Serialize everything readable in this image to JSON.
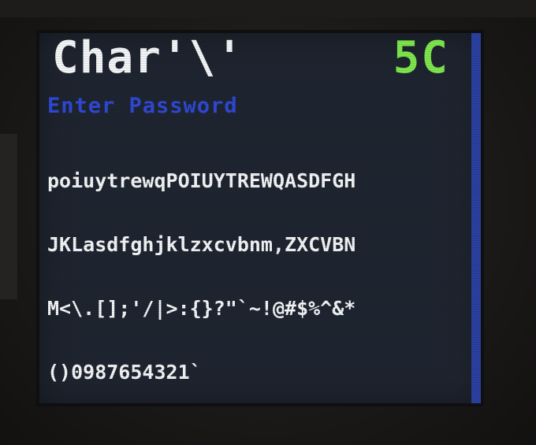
{
  "screen": {
    "title": "Char'\\'",
    "counter": "5C",
    "prompt": "Enter Password",
    "charset_lines": [
      "poiuytrewqPOIUYTREWQASDFGH",
      "JKLasdfghjklzxcvbnm,ZXCVBN",
      "M<\\.[];'/|>:{}?\"`~!@#$%^&*",
      "()0987654321`"
    ]
  },
  "colors": {
    "screen_background": "#1f2530",
    "title_text": "#f2f4f6",
    "counter_text": "#7ee64c",
    "prompt_text": "#2f49d6",
    "scroll_bar": "#2b3fa0"
  }
}
